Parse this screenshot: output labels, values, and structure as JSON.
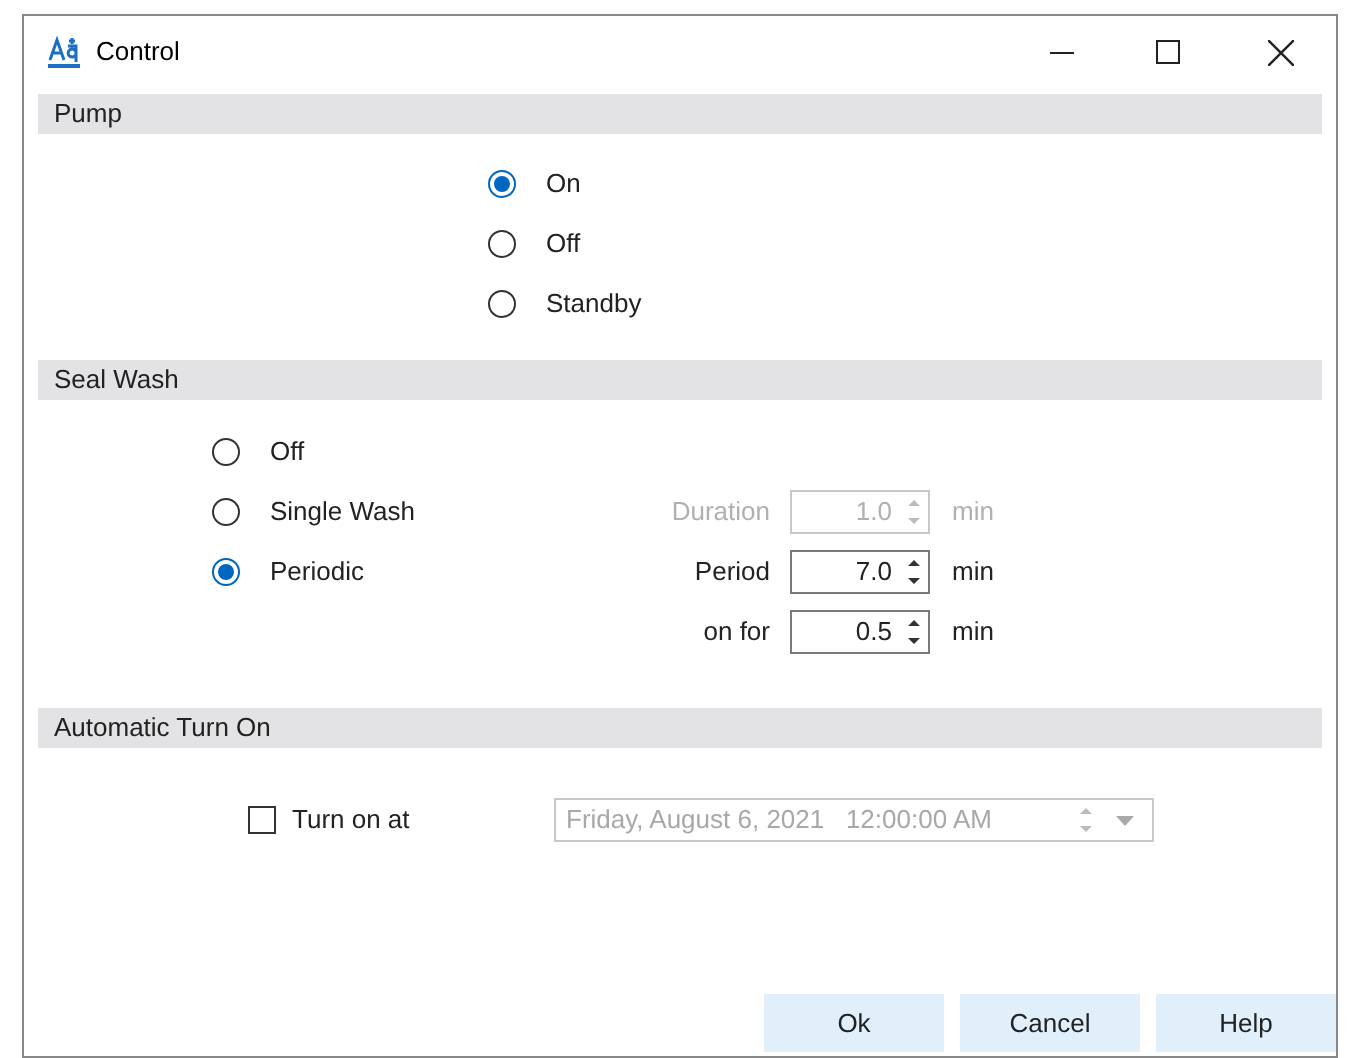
{
  "window": {
    "title": "Control"
  },
  "pump": {
    "heading": "Pump",
    "options": [
      {
        "label": "On",
        "selected": true
      },
      {
        "label": "Off",
        "selected": false
      },
      {
        "label": "Standby",
        "selected": false
      }
    ]
  },
  "seal_wash": {
    "heading": "Seal Wash",
    "options": [
      {
        "label": "Off",
        "selected": false
      },
      {
        "label": "Single Wash",
        "selected": false
      },
      {
        "label": "Periodic",
        "selected": true
      }
    ],
    "fields": [
      {
        "label": "Duration",
        "value": "1.0",
        "unit": "min",
        "disabled": true
      },
      {
        "label": "Period",
        "value": "7.0",
        "unit": "min",
        "disabled": false
      },
      {
        "label": "on for",
        "value": "0.5",
        "unit": "min",
        "disabled": false
      }
    ]
  },
  "automatic_turn_on": {
    "heading": "Automatic Turn On",
    "checkbox": {
      "label": "Turn on at",
      "checked": false
    },
    "datetime": {
      "value": "Friday, August 6, 2021   12:00:00 AM",
      "disabled": true
    }
  },
  "buttons": [
    "Ok",
    "Cancel",
    "Help"
  ]
}
